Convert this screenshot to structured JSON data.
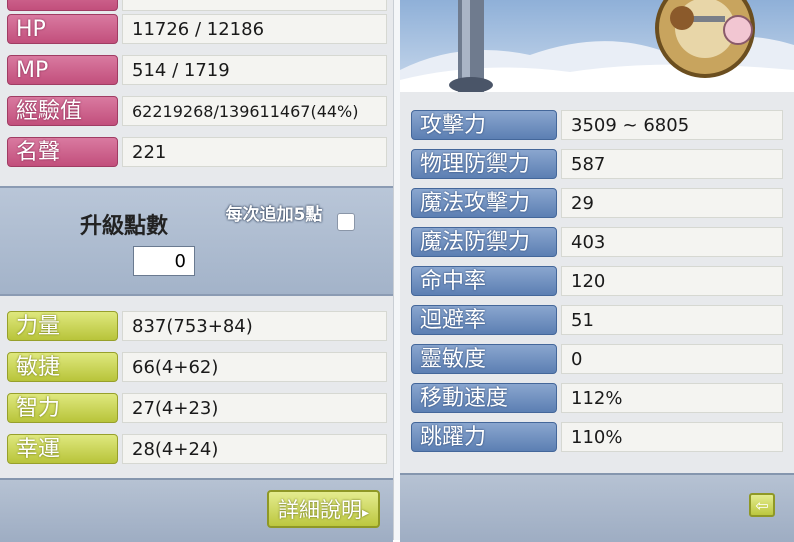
{
  "left_stats": [
    {
      "label": "HP",
      "value": "11726 / 12186"
    },
    {
      "label": "MP",
      "value": "514 / 1719"
    },
    {
      "label": "經驗值",
      "value": "62219268/139611467(44%)"
    },
    {
      "label": "名聲",
      "value": "221"
    }
  ],
  "ability": {
    "title": "升級點數",
    "points": "0",
    "auto_hint": "每次追加5點"
  },
  "attributes": [
    {
      "label": "力量",
      "value": "837(753+84)"
    },
    {
      "label": "敏捷",
      "value": "66(4+62)"
    },
    {
      "label": "智力",
      "value": "27(4+23)"
    },
    {
      "label": "幸運",
      "value": "28(4+24)"
    }
  ],
  "detail_button": "詳細說明",
  "right_stats": [
    {
      "label": "攻擊力",
      "value": "3509 ~ 6805"
    },
    {
      "label": "物理防禦力",
      "value": "587"
    },
    {
      "label": "魔法攻擊力",
      "value": "29"
    },
    {
      "label": "魔法防禦力",
      "value": "403"
    },
    {
      "label": "命中率",
      "value": "120"
    },
    {
      "label": "迴避率",
      "value": "51"
    },
    {
      "label": "靈敏度",
      "value": "0"
    },
    {
      "label": "移動速度",
      "value": "112%"
    },
    {
      "label": "跳躍力",
      "value": "110%"
    }
  ],
  "icons": {
    "back": "back-arrow-icon",
    "detail_arrow": "chevron-right-icon"
  }
}
